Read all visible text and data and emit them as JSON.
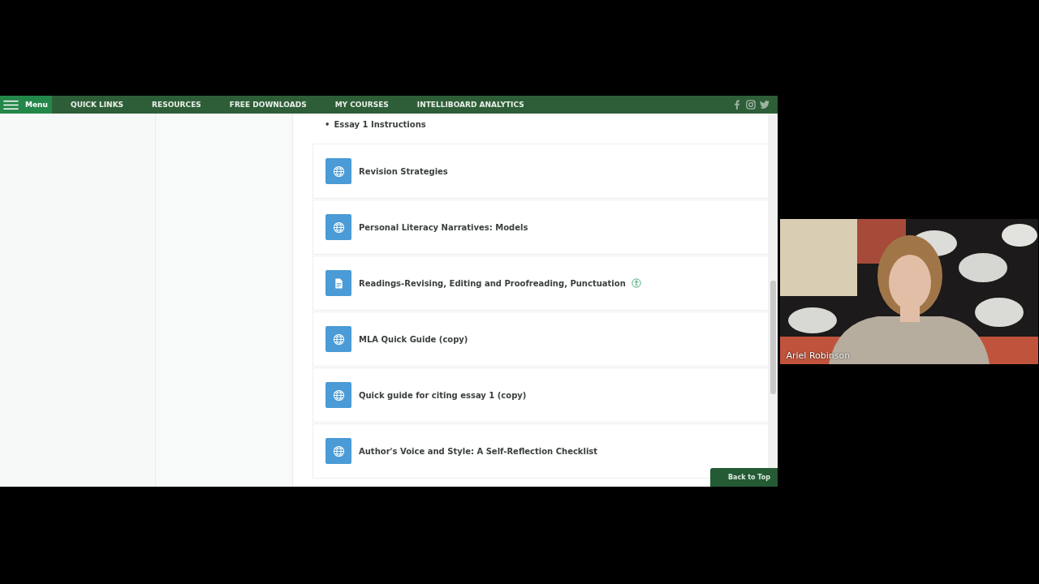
{
  "nav": {
    "menu_label": "Menu",
    "links": [
      "QUICK LINKS",
      "RESOURCES",
      "FREE DOWNLOADS",
      "MY COURSES",
      "INTELLIBOARD ANALYTICS"
    ]
  },
  "section": {
    "bullets": [
      {
        "marker": "•",
        "text": "Essay 1 Instructions"
      }
    ]
  },
  "activities": [
    {
      "kind": "url",
      "title": "Revision Strategies",
      "accessibility": false
    },
    {
      "kind": "url",
      "title": "Personal Literacy Narratives: Models",
      "accessibility": false
    },
    {
      "kind": "file",
      "title": "Readings-Revising, Editing and Proofreading, Punctuation",
      "accessibility": true
    },
    {
      "kind": "url",
      "title": "MLA Quick Guide (copy)",
      "accessibility": false
    },
    {
      "kind": "url",
      "title": "Quick guide for citing essay 1 (copy)",
      "accessibility": false
    },
    {
      "kind": "url",
      "title": "Author's Voice and Style: A Self-Reflection Checklist",
      "accessibility": false
    }
  ],
  "back_to_top": "Back to Top",
  "video": {
    "name": "Ariel Robinson"
  }
}
